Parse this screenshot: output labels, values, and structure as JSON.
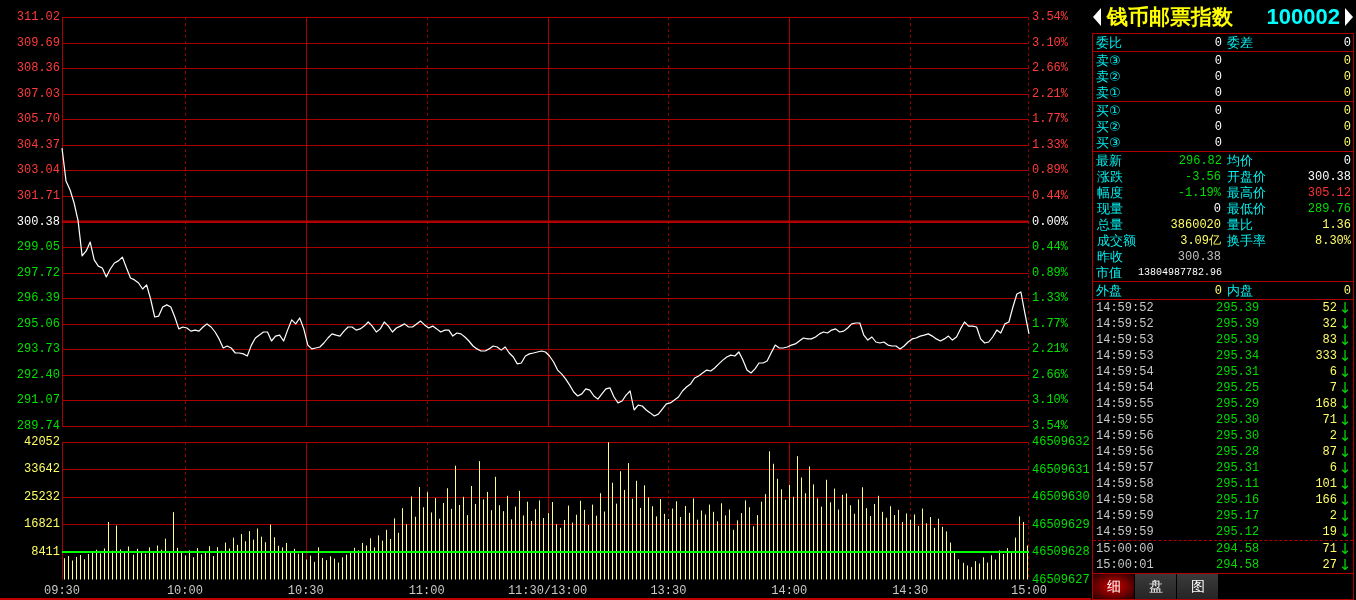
{
  "price_panel": {
    "chart_data": {
      "type": "line",
      "grid": true,
      "ylim": [
        289.74,
        311.02
      ],
      "yticks": [
        {
          "value": 311.02,
          "label": "311.02"
        },
        {
          "value": 309.69,
          "label": "309.69"
        },
        {
          "value": 308.36,
          "label": "308.36"
        },
        {
          "value": 307.03,
          "label": "307.03"
        },
        {
          "value": 305.7,
          "label": "305.70"
        },
        {
          "value": 304.37,
          "label": "304.37"
        },
        {
          "value": 303.04,
          "label": "303.04"
        },
        {
          "value": 301.71,
          "label": "301.71"
        },
        {
          "value": 300.38,
          "label": "300.38"
        },
        {
          "value": 299.05,
          "label": "299.05"
        },
        {
          "value": 297.72,
          "label": "297.72"
        },
        {
          "value": 296.39,
          "label": "296.39"
        },
        {
          "value": 295.06,
          "label": "295.06"
        },
        {
          "value": 293.73,
          "label": "293.73"
        },
        {
          "value": 292.4,
          "label": "292.40"
        },
        {
          "value": 291.07,
          "label": "291.07"
        },
        {
          "value": 289.74,
          "label": "289.74"
        }
      ],
      "series": [
        {
          "color": "#ffffff",
          "values": [
            304.2,
            302.49,
            302.02,
            301.34,
            300.41,
            298.59,
            298.85,
            299.31,
            298.38,
            298.06,
            297.96,
            297.49,
            297.91,
            298.22,
            298.33,
            298.53,
            297.96,
            297.44,
            297.34,
            297.18,
            296.87,
            297.08,
            296.35,
            295.41,
            295.46,
            295.93,
            296.04,
            295.93,
            295.41,
            294.79,
            294.89,
            294.84,
            294.68,
            294.73,
            294.68,
            294.89,
            295.05,
            294.89,
            294.63,
            294.27,
            293.8,
            293.9,
            293.8,
            293.54,
            293.54,
            293.49,
            293.38,
            293.95,
            294.32,
            294.47,
            294.63,
            294.63,
            294.16,
            294.42,
            294.47,
            294.16,
            294.73,
            295.26,
            295.05,
            295.36,
            294.79,
            293.95,
            293.75,
            293.8,
            293.85,
            294.06,
            294.32,
            294.53,
            294.47,
            294.42,
            294.68,
            294.89,
            294.89,
            294.73,
            294.79,
            294.94,
            295.15,
            294.94,
            294.63,
            294.79,
            295.15,
            294.94,
            294.63,
            294.84,
            294.94,
            295.05,
            294.89,
            294.89,
            295.05,
            295.2,
            295.0,
            294.84,
            294.94,
            294.79,
            294.63,
            294.73,
            294.73,
            294.42,
            294.58,
            294.53,
            294.37,
            294.16,
            293.9,
            293.75,
            293.64,
            293.64,
            293.75,
            293.9,
            293.85,
            293.69,
            293.85,
            293.54,
            293.33,
            292.97,
            293.02,
            293.38,
            293.49,
            293.54,
            293.59,
            293.64,
            293.59,
            293.38,
            293.07,
            292.65,
            292.45,
            292.19,
            291.87,
            291.51,
            291.3,
            291.41,
            291.67,
            291.61,
            291.3,
            291.14,
            291.41,
            291.67,
            291.72,
            291.25,
            290.94,
            291.04,
            291.35,
            291.56,
            290.57,
            290.83,
            290.78,
            290.57,
            290.42,
            290.26,
            290.36,
            290.62,
            290.89,
            290.94,
            291.09,
            291.25,
            291.56,
            291.77,
            291.93,
            292.24,
            292.34,
            292.5,
            292.65,
            292.6,
            292.76,
            292.97,
            293.17,
            293.33,
            293.43,
            293.38,
            293.59,
            293.17,
            292.65,
            292.5,
            292.71,
            293.02,
            293.02,
            293.12,
            293.54,
            293.95,
            293.8,
            293.8,
            293.85,
            293.95,
            294.01,
            294.16,
            294.32,
            294.27,
            294.27,
            294.37,
            294.53,
            294.63,
            294.58,
            294.73,
            294.79,
            294.63,
            294.68,
            294.84,
            295.05,
            295.1,
            295.1,
            294.47,
            294.21,
            294.37,
            294.11,
            294.06,
            294.11,
            293.95,
            293.9,
            293.9,
            293.75,
            293.9,
            294.11,
            294.27,
            294.32,
            294.42,
            294.47,
            294.53,
            294.42,
            294.27,
            294.16,
            294.27,
            294.42,
            294.21,
            294.37,
            294.79,
            295.15,
            294.94,
            294.94,
            294.89,
            294.27,
            294.06,
            294.11,
            294.37,
            294.73,
            294.58,
            295.05,
            295.15,
            295.93,
            296.61,
            296.71,
            295.57,
            294.53
          ]
        }
      ],
      "ref_lines": [
        {
          "axis": "y",
          "value": 300.38,
          "color": "#b00000"
        }
      ]
    },
    "percent_labels": [
      "3.54%",
      "3.10%",
      "2.66%",
      "2.21%",
      "1.77%",
      "1.33%",
      "0.89%",
      "0.44%",
      "0.00%",
      "0.44%",
      "0.89%",
      "1.33%",
      "1.77%",
      "2.21%",
      "2.66%",
      "3.10%",
      "3.54%"
    ]
  },
  "volume_panel": {
    "chart_data": {
      "type": "bar",
      "grid": true,
      "ylim": [
        0,
        42052
      ],
      "categories": [
        "09:30",
        null,
        null,
        null,
        null,
        null,
        null,
        null,
        null,
        null,
        null,
        null,
        null,
        null,
        null,
        null,
        null,
        null,
        null,
        null,
        null,
        null,
        null,
        null,
        null,
        null,
        null,
        null,
        null,
        null,
        "10:00",
        null,
        null,
        null,
        null,
        null,
        null,
        null,
        null,
        null,
        null,
        null,
        null,
        null,
        null,
        null,
        null,
        null,
        null,
        null,
        null,
        null,
        null,
        null,
        null,
        null,
        null,
        null,
        null,
        null,
        "10:30",
        null,
        null,
        null,
        null,
        null,
        null,
        null,
        null,
        null,
        null,
        null,
        null,
        null,
        null,
        null,
        null,
        null,
        null,
        null,
        null,
        null,
        null,
        null,
        null,
        null,
        null,
        null,
        null,
        null,
        "11:00",
        null,
        null,
        null,
        null,
        null,
        null,
        null,
        null,
        null,
        null,
        null,
        null,
        null,
        null,
        null,
        null,
        null,
        null,
        null,
        null,
        null,
        null,
        null,
        null,
        null,
        null,
        null,
        null,
        null,
        "11:30/13:00",
        null,
        null,
        null,
        null,
        null,
        null,
        null,
        null,
        null,
        null,
        null,
        null,
        null,
        null,
        null,
        null,
        null,
        null,
        null,
        null,
        null,
        null,
        null,
        null,
        null,
        null,
        null,
        null,
        null,
        "13:30",
        null,
        null,
        null,
        null,
        null,
        null,
        null,
        null,
        null,
        null,
        null,
        null,
        null,
        null,
        null,
        null,
        null,
        null,
        null,
        null,
        null,
        null,
        null,
        null,
        null,
        null,
        null,
        null,
        null,
        "14:00",
        null,
        null,
        null,
        null,
        null,
        null,
        null,
        null,
        null,
        null,
        null,
        null,
        null,
        null,
        null,
        null,
        null,
        null,
        null,
        null,
        null,
        null,
        null,
        null,
        null,
        null,
        null,
        null,
        null,
        "14:30",
        null,
        null,
        null,
        null,
        null,
        null,
        null,
        null,
        null,
        null,
        null,
        null,
        null,
        null,
        null,
        null,
        null,
        null,
        null,
        null,
        null,
        null,
        null,
        null,
        null,
        null,
        null,
        null,
        "15:00"
      ],
      "yticks": [
        42052,
        33642,
        25232,
        16821,
        8411
      ],
      "series": [
        {
          "color": "#ffff88",
          "values": [
            6500,
            7200,
            5800,
            6900,
            7500,
            6200,
            7800,
            8400,
            9100,
            8000,
            9500,
            17600,
            8800,
            16500,
            9200,
            8700,
            10100,
            7600,
            9400,
            8300,
            7900,
            9800,
            8600,
            10400,
            9100,
            12500,
            8200,
            20600,
            9700,
            8100,
            7400,
            8900,
            6800,
            9600,
            7700,
            8500,
            10200,
            7200,
            9900,
            8800,
            11300,
            9500,
            12800,
            10600,
            13900,
            11700,
            14800,
            12200,
            15600,
            13100,
            11400,
            16800,
            12900,
            10300,
            9800,
            11200,
            8700,
            9400,
            7900,
            8600,
            6100,
            7300,
            5400,
            9800,
            6600,
            5900,
            7100,
            6400,
            5200,
            6800,
            7600,
            8300,
            9700,
            8900,
            11200,
            10400,
            12600,
            9800,
            13500,
            11900,
            15200,
            12400,
            18700,
            14300,
            21800,
            16900,
            25400,
            19200,
            28300,
            22100,
            26700,
            20500,
            24900,
            18600,
            23400,
            27900,
            21600,
            34800,
            22800,
            25300,
            19700,
            28600,
            23100,
            36200,
            24500,
            26800,
            21200,
            31400,
            22700,
            20900,
            25600,
            18400,
            22300,
            27100,
            19600,
            23800,
            17900,
            21500,
            24200,
            18800,
            20300,
            23700,
            16900,
            15800,
            18200,
            22600,
            17400,
            19800,
            24100,
            21300,
            16700,
            22900,
            19500,
            26400,
            20800,
            42000,
            29600,
            23200,
            33100,
            27400,
            35600,
            24700,
            30200,
            21900,
            28800,
            25100,
            22400,
            19300,
            24600,
            20100,
            18500,
            21700,
            23900,
            19100,
            22500,
            20400,
            24800,
            18300,
            21100,
            19900,
            22900,
            20700,
            17800,
            23300,
            19600,
            21400,
            15200,
            18100,
            20300,
            24200,
            22100,
            16300,
            19700,
            23800,
            26100,
            39200,
            35400,
            30800,
            27600,
            24400,
            28900,
            25300,
            37700,
            31200,
            26400,
            34600,
            29100,
            24800,
            22300,
            30500,
            23600,
            27800,
            21400,
            25900,
            26300,
            22700,
            20100,
            24500,
            28200,
            21800,
            19400,
            23100,
            25600,
            20700,
            18900,
            22400,
            19700,
            21300,
            17600,
            20200,
            18300,
            19900,
            16400,
            21700,
            17200,
            19100,
            15800,
            18600,
            16100,
            14700,
            11300,
            8600,
            6200,
            5100,
            4300,
            3800,
            5600,
            4900,
            6800,
            5200,
            7400,
            6100,
            8900,
            7800,
            9600,
            8200,
            12800,
            19300,
            17600,
            10400
          ]
        }
      ],
      "ref_lines": [
        {
          "axis": "y",
          "value": 8411,
          "color": "#00ff00"
        }
      ]
    },
    "right_axis_labels": [
      "46509632",
      "46509631",
      "46509630",
      "46509629",
      "46509628",
      "46509627"
    ]
  },
  "quote_panel": {
    "title": {
      "name": "钱币邮票指数",
      "code": "100002"
    },
    "order_summary": [
      {
        "label": "委比",
        "value": "0"
      },
      {
        "label": "委差",
        "value": "0"
      }
    ],
    "asks": [
      {
        "label": "卖③",
        "price": "0",
        "volume": "0"
      },
      {
        "label": "卖②",
        "price": "0",
        "volume": "0"
      },
      {
        "label": "卖①",
        "price": "0",
        "volume": "0"
      }
    ],
    "bids": [
      {
        "label": "买①",
        "price": "0",
        "volume": "0"
      },
      {
        "label": "买②",
        "price": "0",
        "volume": "0"
      },
      {
        "label": "买③",
        "price": "0",
        "volume": "0"
      }
    ],
    "stats": [
      {
        "label": "最新",
        "value": "296.82",
        "color": "#00dd00"
      },
      {
        "label": "均价",
        "value": "0",
        "color": "#ffffff"
      },
      {
        "label": "涨跌",
        "value": "-3.56",
        "color": "#00dd00"
      },
      {
        "label": "开盘价",
        "value": "300.38",
        "color": "#ffffff"
      },
      {
        "label": "幅度",
        "value": "-1.19%",
        "color": "#00dd00"
      },
      {
        "label": "最高价",
        "value": "305.12",
        "color": "#ff3333"
      },
      {
        "label": "现量",
        "value": "0",
        "color": "#ffffff"
      },
      {
        "label": "最低价",
        "value": "289.76",
        "color": "#00dd00"
      },
      {
        "label": "总量",
        "value": "3860020",
        "color": "#ffff66"
      },
      {
        "label": "量比",
        "value": "1.36",
        "color": "#ffff66"
      },
      {
        "label": "成交额",
        "value": "3.09亿",
        "color": "#ffff66"
      },
      {
        "label": "换手率",
        "value": "8.30%",
        "color": "#ffff66"
      },
      {
        "label": "昨收",
        "value": "300.38",
        "color": "#c0c0c0"
      }
    ],
    "market_value": {
      "label": "市值",
      "value": "13804987782.96"
    },
    "outer_inner": [
      {
        "label": "外盘",
        "value": "0"
      },
      {
        "label": "内盘",
        "value": "0"
      }
    ],
    "ticks": [
      {
        "time": "14:59:52",
        "price": "295.39",
        "volume": "52",
        "arrow": "↓"
      },
      {
        "time": "14:59:52",
        "price": "295.39",
        "volume": "32",
        "arrow": "↓"
      },
      {
        "time": "14:59:53",
        "price": "295.39",
        "volume": "83",
        "arrow": "↓"
      },
      {
        "time": "14:59:53",
        "price": "295.34",
        "volume": "333",
        "arrow": "↓"
      },
      {
        "time": "14:59:54",
        "price": "295.31",
        "volume": "6",
        "arrow": "↓"
      },
      {
        "time": "14:59:54",
        "price": "295.25",
        "volume": "7",
        "arrow": "↓"
      },
      {
        "time": "14:59:55",
        "price": "295.29",
        "volume": "168",
        "arrow": "↓"
      },
      {
        "time": "14:59:55",
        "price": "295.30",
        "volume": "71",
        "arrow": "↓"
      },
      {
        "time": "14:59:56",
        "price": "295.30",
        "volume": "2",
        "arrow": "↓"
      },
      {
        "time": "14:59:56",
        "price": "295.28",
        "volume": "87",
        "arrow": "↓"
      },
      {
        "time": "14:59:57",
        "price": "295.31",
        "volume": "6",
        "arrow": "↓"
      },
      {
        "time": "14:59:58",
        "price": "295.11",
        "volume": "101",
        "arrow": "↓"
      },
      {
        "time": "14:59:58",
        "price": "295.16",
        "volume": "166",
        "arrow": "↓"
      },
      {
        "time": "14:59:59",
        "price": "295.17",
        "volume": "2",
        "arrow": "↓"
      },
      {
        "time": "14:59:59",
        "price": "295.12",
        "volume": "19",
        "arrow": "↓"
      }
    ],
    "closing_ticks": [
      {
        "time": "15:00:00",
        "price": "294.58",
        "volume": "71",
        "arrow": "↓"
      },
      {
        "time": "15:00:01",
        "price": "294.58",
        "volume": "27",
        "arrow": "↓"
      }
    ],
    "tabs": [
      {
        "label": "细",
        "selected": true
      },
      {
        "label": "盘",
        "selected": false
      },
      {
        "label": "图",
        "selected": false
      }
    ]
  }
}
